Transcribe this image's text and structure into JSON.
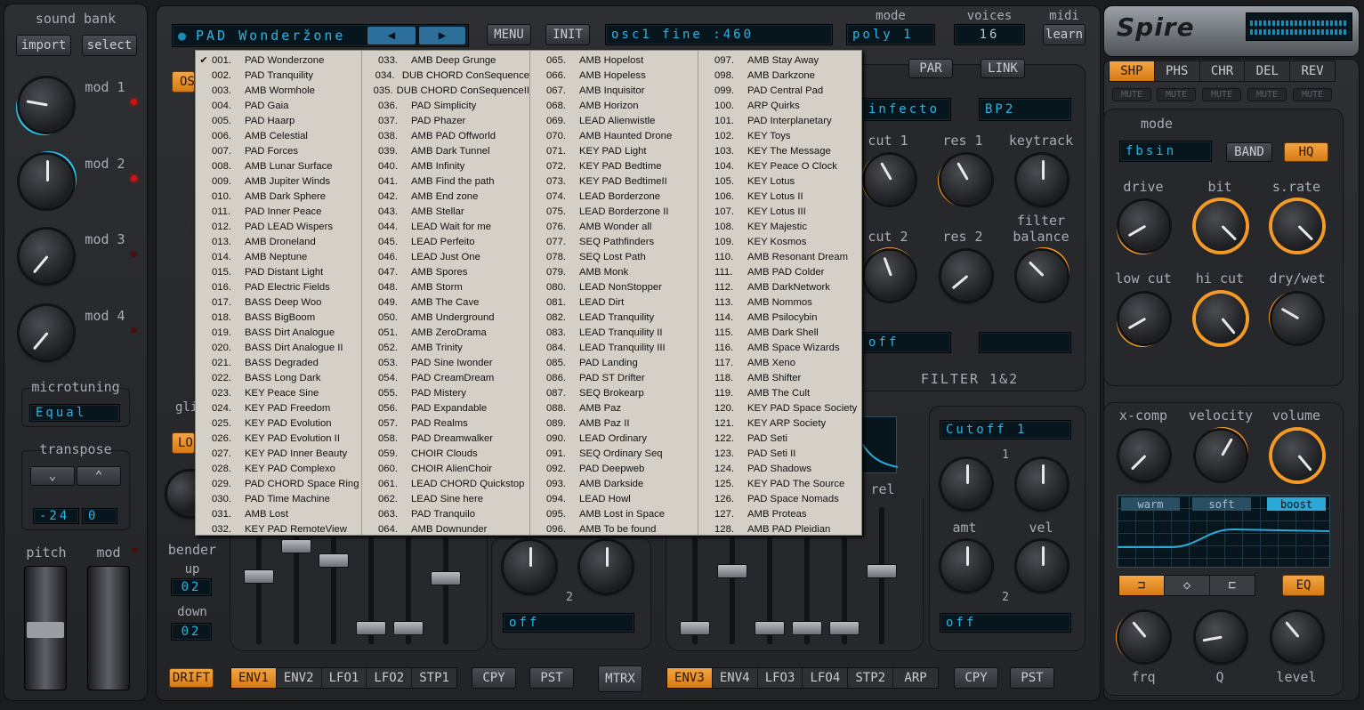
{
  "left_panel": {
    "sound_bank_label": "sound bank",
    "import_label": "import",
    "select_label": "select",
    "mod1": "mod 1",
    "mod2": "mod 2",
    "mod3": "mod 3",
    "mod4": "mod 4",
    "microtuning_label": "microtuning",
    "microtuning_value": "Equal",
    "transpose_label": "transpose",
    "transpose_a": "-24",
    "transpose_b": "0",
    "pitch_label": "pitch",
    "mod_label": "mod",
    "down_arrow": "⌄",
    "up_arrow": "⌃"
  },
  "top_bar": {
    "preset_name": "PAD Wonderžone",
    "menu_label": "MENU",
    "init_label": "INIT",
    "param_display": "osc1 fine      :460",
    "mode_label": "mode",
    "mode_value": "poly 1",
    "voices_label": "voices",
    "voices_value": "16",
    "midi_label": "midi",
    "learn_label": "learn",
    "logo": "Spire"
  },
  "fx": {
    "tabs": [
      "SHP",
      "PHS",
      "CHR",
      "DEL",
      "REV"
    ],
    "active_tab": "SHP",
    "mute_labels": [
      "MUTE",
      "MUTE",
      "MUTE",
      "MUTE",
      "MUTE"
    ],
    "mode_label": "mode",
    "mode_value": "fbsin",
    "band_label": "BAND",
    "hq_label": "HQ",
    "knobs_row1": [
      "drive",
      "bit",
      "s.rate"
    ],
    "knobs_row2": [
      "low cut",
      "hi cut",
      "dry/wet"
    ],
    "knobs_row3": [
      "x-comp",
      "velocity",
      "volume"
    ],
    "eq_tabs": [
      "warm",
      "soft",
      "boost"
    ],
    "eq_label": "EQ",
    "knobs_row4": [
      "frq",
      "Q",
      "level"
    ]
  },
  "filter": {
    "par_label": "PAR",
    "link_label": "LINK",
    "filter1_type": "infecto",
    "filter2_type": "BP2",
    "cut1": "cut 1",
    "res1": "res 1",
    "keytrack": "keytrack",
    "cut2": "cut 2",
    "res2": "res 2",
    "filter_balance": "filter\nbalance",
    "off_a": "off",
    "section_label": "FILTER 1&2"
  },
  "mod_section": {
    "cutoff_display": "Cutoff 1",
    "one_label": "1",
    "two_label": "2",
    "amt_label": "amt",
    "vel_label": "vel",
    "rel_label": "rel",
    "off_left": "off",
    "off_right": "off",
    "two_small": "2"
  },
  "bottom": {
    "bender_label": "bender",
    "up_label": "up",
    "up_value": "02",
    "down_label": "down",
    "down_value": "02",
    "drift_label": "DRIFT",
    "env_tabs_left": [
      "ENV1",
      "ENV2",
      "LFO1",
      "LFO2",
      "STP1"
    ],
    "env_tabs_right": [
      "ENV3",
      "ENV4",
      "LFO3",
      "LFO4",
      "STP2",
      "ARP"
    ],
    "cpy_label": "CPY",
    "pst_label": "PST",
    "mtrx_label": "MTRX",
    "glide_partial": "gli",
    "lo_partial": "LO",
    "os_partial": "OS"
  },
  "preset_menu": {
    "checked_item": "001.",
    "columns": [
      [
        [
          "001.",
          "PAD Wonderzone"
        ],
        [
          "002.",
          "PAD Tranquility"
        ],
        [
          "003.",
          "AMB Wormhole"
        ],
        [
          "004.",
          "PAD Gaia"
        ],
        [
          "005.",
          "PAD Haarp"
        ],
        [
          "006.",
          "AMB Celestial"
        ],
        [
          "007.",
          "PAD Forces"
        ],
        [
          "008.",
          "AMB Lunar Surface"
        ],
        [
          "009.",
          "AMB Jupiter Winds"
        ],
        [
          "010.",
          "AMB Dark Sphere"
        ],
        [
          "011.",
          "PAD Inner Peace"
        ],
        [
          "012.",
          "PAD LEAD Wispers"
        ],
        [
          "013.",
          "AMB Droneland"
        ],
        [
          "014.",
          "AMB Neptune"
        ],
        [
          "015.",
          "PAD Distant Light"
        ],
        [
          "016.",
          "PAD Electric Fields"
        ],
        [
          "017.",
          "BASS Deep Woo"
        ],
        [
          "018.",
          "BASS BigBoom"
        ],
        [
          "019.",
          "BASS Dirt Analogue"
        ],
        [
          "020.",
          "BASS Dirt Analogue II"
        ],
        [
          "021.",
          "BASS Degraded"
        ],
        [
          "022.",
          "BASS Long Dark"
        ],
        [
          "023.",
          "KEY Peace Sine"
        ],
        [
          "024.",
          "KEY PAD Freedom"
        ],
        [
          "025.",
          "KEY PAD Evolution"
        ],
        [
          "026.",
          "KEY PAD Evolution II"
        ],
        [
          "027.",
          "KEY PAD Inner Beauty"
        ],
        [
          "028.",
          "KEY PAD Complexo"
        ],
        [
          "029.",
          "PAD CHORD Space Ring"
        ],
        [
          "030.",
          "PAD Time Machine"
        ],
        [
          "031.",
          "AMB Lost"
        ],
        [
          "032.",
          "KEY PAD RemoteView"
        ]
      ],
      [
        [
          "033.",
          "AMB Deep Grunge"
        ],
        [
          "034.",
          "DUB CHORD ConSequence"
        ],
        [
          "035.",
          "DUB CHORD ConSequenceII"
        ],
        [
          "036.",
          "PAD Simplicity"
        ],
        [
          "037.",
          "PAD Phazer"
        ],
        [
          "038.",
          "AMB PAD Offworld"
        ],
        [
          "039.",
          "AMB Dark Tunnel"
        ],
        [
          "040.",
          "AMB Infinity"
        ],
        [
          "041.",
          "AMB Find the path"
        ],
        [
          "042.",
          "AMB End zone"
        ],
        [
          "043.",
          "AMB Stellar"
        ],
        [
          "044.",
          "LEAD Wait for me"
        ],
        [
          "045.",
          "LEAD Perfeito"
        ],
        [
          "046.",
          "LEAD Just One"
        ],
        [
          "047.",
          "AMB Spores"
        ],
        [
          "048.",
          "AMB Storm"
        ],
        [
          "049.",
          "AMB The Cave"
        ],
        [
          "050.",
          "AMB Underground"
        ],
        [
          "051.",
          "AMB ZeroDrama"
        ],
        [
          "052.",
          "AMB Trinity"
        ],
        [
          "053.",
          "PAD Sine Iwonder"
        ],
        [
          "054.",
          "PAD CreamDream"
        ],
        [
          "055.",
          "PAD Mistery"
        ],
        [
          "056.",
          "PAD Expandable"
        ],
        [
          "057.",
          "PAD Realms"
        ],
        [
          "058.",
          "PAD Dreamwalker"
        ],
        [
          "059.",
          "CHOIR Clouds"
        ],
        [
          "060.",
          "CHOIR AlienChoir"
        ],
        [
          "061.",
          "LEAD CHORD Quickstop"
        ],
        [
          "062.",
          "LEAD Sine here"
        ],
        [
          "063.",
          "PAD Tranquilo"
        ],
        [
          "064.",
          "AMB Downunder"
        ]
      ],
      [
        [
          "065.",
          "AMB Hopelost"
        ],
        [
          "066.",
          "AMB Hopeless"
        ],
        [
          "067.",
          "AMB Inquisitor"
        ],
        [
          "068.",
          "AMB Horizon"
        ],
        [
          "069.",
          "LEAD Alienwistle"
        ],
        [
          "070.",
          "AMB Haunted Drone"
        ],
        [
          "071.",
          "KEY PAD Light"
        ],
        [
          "072.",
          "KEY PAD Bedtime"
        ],
        [
          "073.",
          "KEY PAD BedtimeII"
        ],
        [
          "074.",
          "LEAD Borderzone"
        ],
        [
          "075.",
          "LEAD Borderzone II"
        ],
        [
          "076.",
          "AMB Wonder all"
        ],
        [
          "077.",
          "SEQ Pathfinders"
        ],
        [
          "078.",
          "SEQ Lost Path"
        ],
        [
          "079.",
          "AMB Monk"
        ],
        [
          "080.",
          "LEAD NonStopper"
        ],
        [
          "081.",
          "LEAD Dirt"
        ],
        [
          "082.",
          "LEAD Tranquility"
        ],
        [
          "083.",
          "LEAD Tranquility II"
        ],
        [
          "084.",
          "LEAD Tranquility III"
        ],
        [
          "085.",
          "PAD Landing"
        ],
        [
          "086.",
          "PAD ST Drifter"
        ],
        [
          "087.",
          "SEQ Brokearp"
        ],
        [
          "088.",
          "AMB Paz"
        ],
        [
          "089.",
          "AMB Paz II"
        ],
        [
          "090.",
          "LEAD Ordinary"
        ],
        [
          "091.",
          "SEQ Ordinary Seq"
        ],
        [
          "092.",
          "PAD Deepweb"
        ],
        [
          "093.",
          "AMB Darkside"
        ],
        [
          "094.",
          "LEAD Howl"
        ],
        [
          "095.",
          "AMB Lost in Space"
        ],
        [
          "096.",
          "AMB To be found"
        ]
      ],
      [
        [
          "097.",
          "AMB Stay Away"
        ],
        [
          "098.",
          "AMB Darkzone"
        ],
        [
          "099.",
          "PAD Central Pad"
        ],
        [
          "100.",
          "ARP Quirks"
        ],
        [
          "101.",
          "PAD Interplanetary"
        ],
        [
          "102.",
          "KEY Toys"
        ],
        [
          "103.",
          "KEY The Message"
        ],
        [
          "104.",
          "KEY Peace O Clock"
        ],
        [
          "105.",
          "KEY Lotus"
        ],
        [
          "106.",
          "KEY Lotus II"
        ],
        [
          "107.",
          "KEY Lotus III"
        ],
        [
          "108.",
          "KEY Majestic"
        ],
        [
          "109.",
          "KEY Kosmos"
        ],
        [
          "110.",
          "AMB Resonant Dream"
        ],
        [
          "111.",
          "AMB PAD Colder"
        ],
        [
          "112.",
          "AMB DarkNetwork"
        ],
        [
          "113.",
          "AMB Nommos"
        ],
        [
          "114.",
          "AMB Psilocybin"
        ],
        [
          "115.",
          "AMB Dark Shell"
        ],
        [
          "116.",
          "AMB Space Wizards"
        ],
        [
          "117.",
          "AMB Xeno"
        ],
        [
          "118.",
          "AMB Shifter"
        ],
        [
          "119.",
          "AMB The Cult"
        ],
        [
          "120.",
          "KEY PAD Space Society"
        ],
        [
          "121.",
          "KEY ARP Society"
        ],
        [
          "122.",
          "PAD Seti"
        ],
        [
          "123.",
          "PAD Seti II"
        ],
        [
          "124.",
          "PAD Shadows"
        ],
        [
          "125.",
          "KEY PAD The Source"
        ],
        [
          "126.",
          "PAD Space Nomads"
        ],
        [
          "127.",
          "AMB Proteas"
        ],
        [
          "128.",
          "AMB PAD Pleidian"
        ]
      ]
    ]
  }
}
